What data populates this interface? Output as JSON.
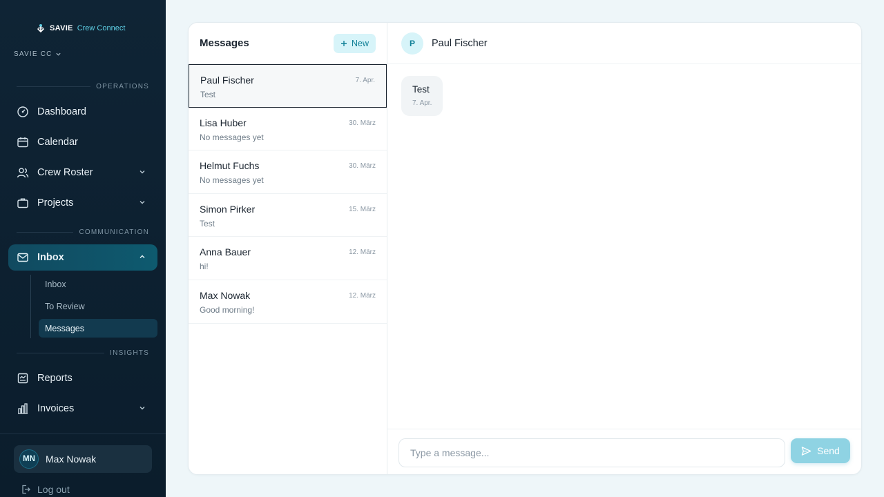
{
  "brand": {
    "name": "SAVIE",
    "subtitle": "Crew Connect",
    "org": "SAVIE CC"
  },
  "sidebar": {
    "sections": {
      "operations": "OPERATIONS",
      "communication": "COMMUNICATION",
      "insights": "INSIGHTS"
    },
    "items": {
      "dashboard": "Dashboard",
      "calendar": "Calendar",
      "crew_roster": "Crew Roster",
      "projects": "Projects",
      "inbox": "Inbox",
      "reports": "Reports",
      "invoices": "Invoices"
    },
    "inbox_sub": {
      "inbox": "Inbox",
      "to_review": "To Review",
      "messages": "Messages"
    }
  },
  "user": {
    "initials": "MN",
    "name": "Max Nowak",
    "logout": "Log out"
  },
  "messages": {
    "title": "Messages",
    "new_label": "New",
    "conversations": [
      {
        "name": "Paul Fischer",
        "date": "7. Apr.",
        "preview": "Test"
      },
      {
        "name": "Lisa Huber",
        "date": "30. März",
        "preview": "No messages yet"
      },
      {
        "name": "Helmut Fuchs",
        "date": "30. März",
        "preview": "No messages yet"
      },
      {
        "name": "Simon Pirker",
        "date": "15. März",
        "preview": "Test"
      },
      {
        "name": "Anna Bauer",
        "date": "12. März",
        "preview": "hi!"
      },
      {
        "name": "Max Nowak",
        "date": "12. März",
        "preview": "Good morning!"
      }
    ]
  },
  "chat": {
    "initial": "P",
    "name": "Paul Fischer",
    "bubble": {
      "text": "Test",
      "time": "7. Apr."
    },
    "placeholder": "Type a message...",
    "send_label": "Send"
  },
  "colors": {
    "accent": "#0f7f96",
    "sidebar_bg": "#0f2435",
    "active_nav": "#114a60",
    "send_button": "#8fd3e3"
  }
}
